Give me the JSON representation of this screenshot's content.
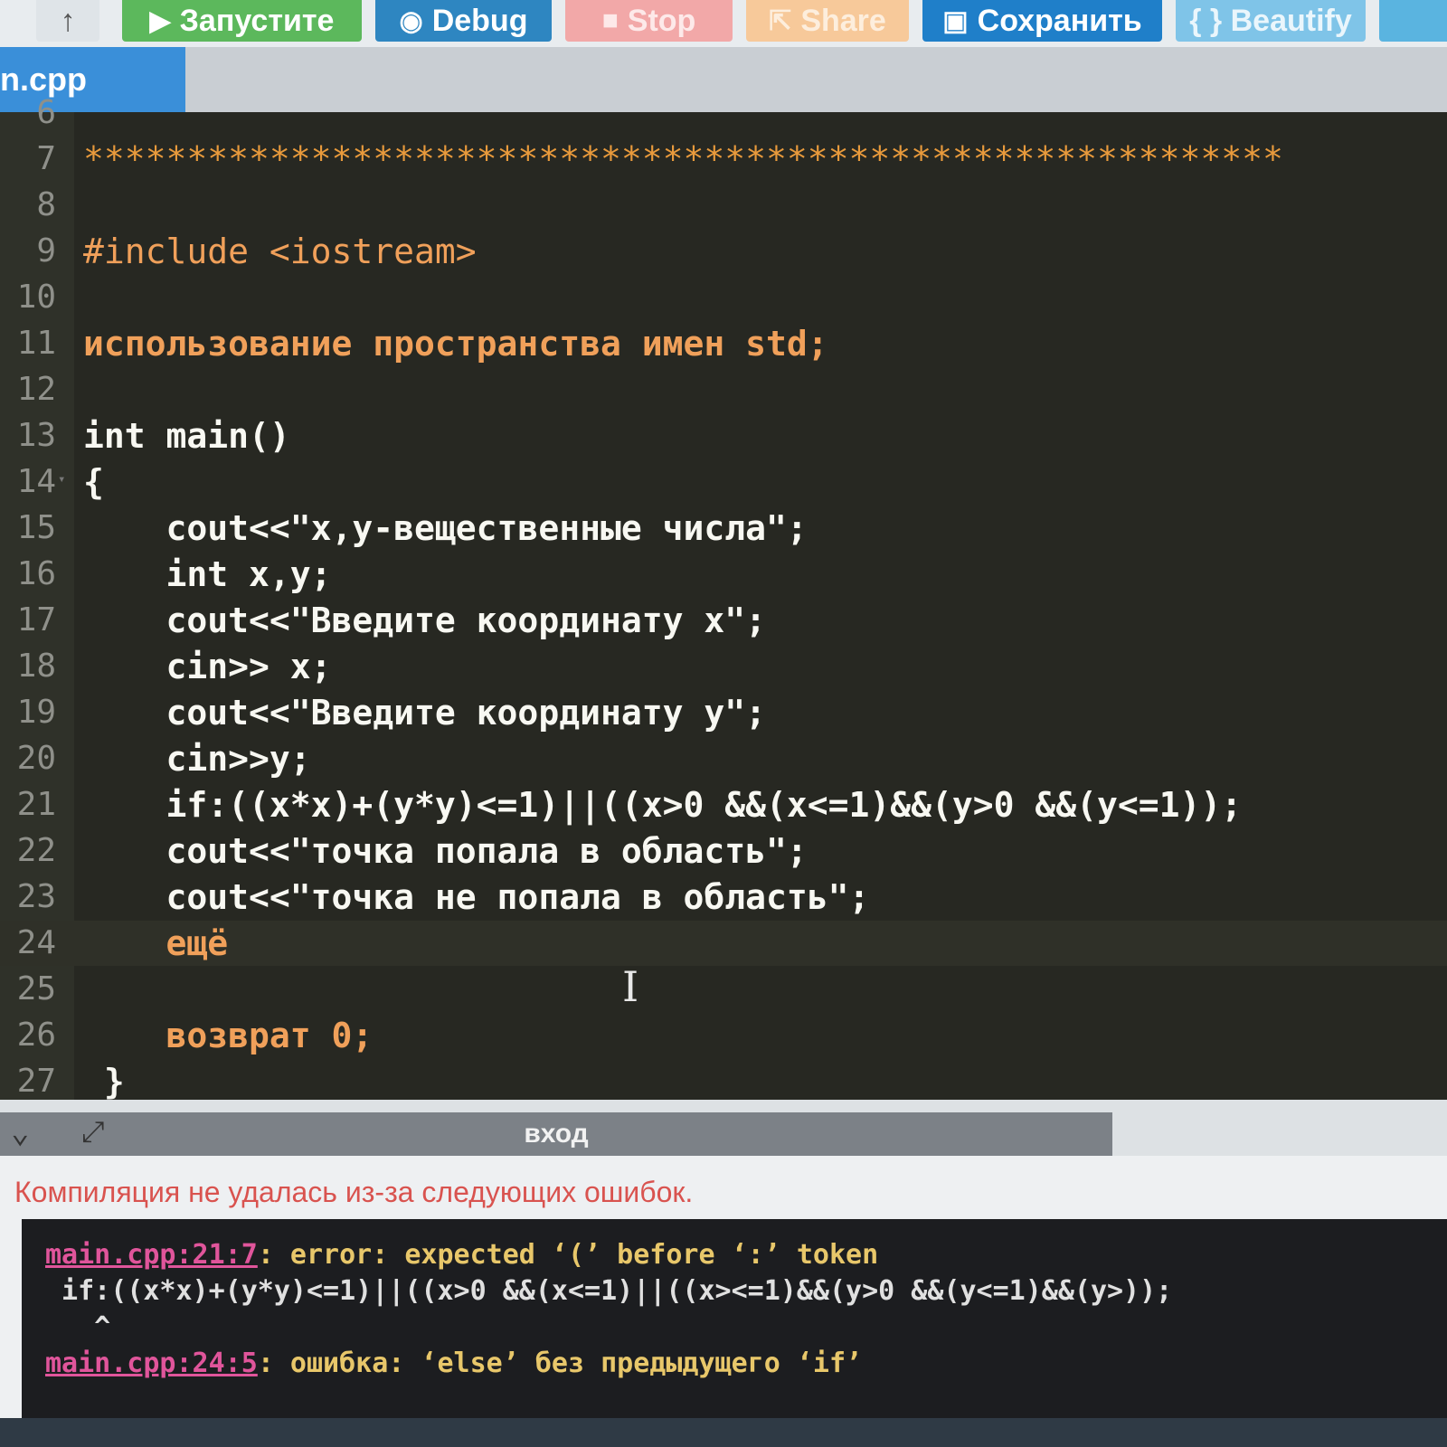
{
  "toolbar": {
    "upload_icon": "upload-arrow-icon",
    "run_label": "Запустите",
    "debug_label": "Debug",
    "stop_label": "Stop",
    "share_label": "Share",
    "save_label": "Сохранить",
    "beautify_label": "{ } Beautify"
  },
  "tab": {
    "label": "n.cpp"
  },
  "editor": {
    "lines": [
      {
        "n": "6",
        "text": ""
      },
      {
        "n": "7",
        "text": "**********************************************************"
      },
      {
        "n": "8",
        "text": ""
      },
      {
        "n": "9",
        "text": "#include <iostream>"
      },
      {
        "n": "10",
        "text": ""
      },
      {
        "n": "11",
        "text": "использование пространства имен std;"
      },
      {
        "n": "12",
        "text": ""
      },
      {
        "n": "13",
        "text": "int main()"
      },
      {
        "n": "14",
        "text": "{"
      },
      {
        "n": "15",
        "text": "    cout<<\"x,y-вещественные числа\";"
      },
      {
        "n": "16",
        "text": "    int x,y;"
      },
      {
        "n": "17",
        "text": "    cout<<\"Введите координату x\";"
      },
      {
        "n": "18",
        "text": "    cin>> x;"
      },
      {
        "n": "19",
        "text": "    cout<<\"Введите координату y\";"
      },
      {
        "n": "20",
        "text": "    cin>>y;"
      },
      {
        "n": "21",
        "text": "    if:((x*x)+(y*y)<=1)||((x>0 &&(x<=1)&&(y>0 &&(y<=1));"
      },
      {
        "n": "22",
        "text": "    cout<<\"точка попала в область\";"
      },
      {
        "n": "23",
        "text": "    cout<<\"точка не попала в область\";"
      },
      {
        "n": "24",
        "text": "    ещё"
      },
      {
        "n": "25",
        "text": ""
      },
      {
        "n": "26",
        "text": "    возврат 0;"
      },
      {
        "n": "27",
        "text": " }"
      }
    ]
  },
  "output": {
    "title": "вход",
    "message": "Компиляция не удалась из-за следующих ошибок.",
    "errors": [
      {
        "loc": "main.cpp:21:7",
        "text": ": error: expected ‘(’ before ‘:’ token"
      },
      {
        "loc": "",
        "text": " if:((x*x)+(y*y)<=1)||((x>0 &&(x<=1)||((x><=1)&&(y>0 &&(y<=1)&&(y>));"
      },
      {
        "loc": "",
        "text": "   ^"
      },
      {
        "loc": "main.cpp:24:5",
        "text": ": ошибка: ‘else’ без предыдущего ‘if’"
      }
    ]
  }
}
